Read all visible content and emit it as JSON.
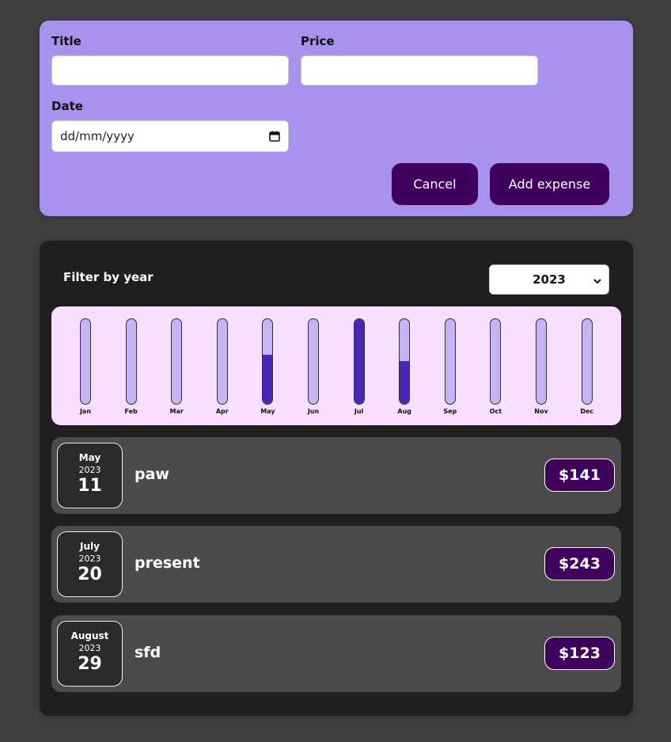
{
  "form": {
    "title_label": "Title",
    "title_value": "",
    "price_label": "Price",
    "price_value": "",
    "date_label": "Date",
    "date_placeholder": "dd/mm/yyyy",
    "cancel_label": "Cancel",
    "add_label": "Add expense"
  },
  "filter": {
    "label": "Filter by year",
    "selected_year": "2023"
  },
  "chart_data": {
    "type": "bar",
    "categories": [
      "Jan",
      "Feb",
      "Mar",
      "Apr",
      "May",
      "Jun",
      "Jul",
      "Aug",
      "Sep",
      "Oct",
      "Nov",
      "Dec"
    ],
    "values": [
      0,
      0,
      0,
      0,
      141,
      0,
      243,
      123,
      0,
      0,
      0,
      0
    ],
    "max": 243,
    "colors": {
      "fill": "#4826b9",
      "empty": "#c3b4f3"
    }
  },
  "expenses": [
    {
      "month": "May",
      "year": "2023",
      "day": "11",
      "title": "paw",
      "amount": "$141"
    },
    {
      "month": "July",
      "year": "2023",
      "day": "20",
      "title": "present",
      "amount": "$243"
    },
    {
      "month": "August",
      "year": "2023",
      "day": "29",
      "title": "sfd",
      "amount": "$123"
    }
  ],
  "colors": {
    "form_bg": "#a892ee",
    "button": "#40005d",
    "panel_bg": "#1f1f1f",
    "item_bg": "#4b4b4b",
    "chart_bg": "#f8dfff"
  }
}
